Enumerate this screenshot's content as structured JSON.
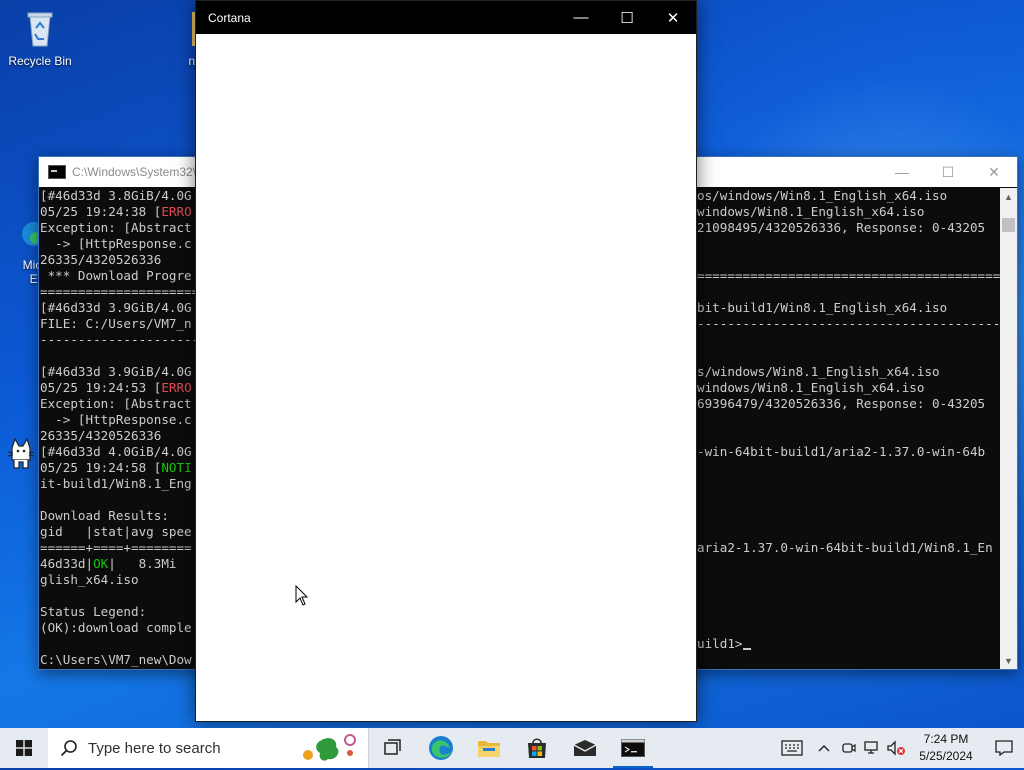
{
  "desktop": {
    "icons": [
      {
        "label": "Recycle Bin"
      },
      {
        "label": "nek"
      },
      {
        "label": "Micr"
      },
      {
        "label": "Ed"
      }
    ]
  },
  "console_window": {
    "title": "C:\\Windows\\System32\\",
    "controls": {
      "minimize": "—",
      "maximize": "☐",
      "close": "✕"
    }
  },
  "cortana_window": {
    "title": "Cortana",
    "controls": {
      "minimize": "—",
      "maximize": "☐",
      "close": "✕"
    }
  },
  "console_left_lines": [
    {
      "text": "[#46d33d 3.8GiB/4.0G",
      "colored": ""
    },
    {
      "text": "05/25 19:24:38 [",
      "colored": "ERRO"
    },
    {
      "text": "Exception: [Abstract",
      "colored": ""
    },
    {
      "text": "  -> [HttpResponse.c",
      "colored": ""
    },
    {
      "text": "26335/4320526336",
      "colored": ""
    },
    {
      "text": " *** Download Progre",
      "colored": ""
    },
    {
      "text": "=====================",
      "colored": ""
    },
    {
      "text": "[#46d33d 3.9GiB/4.0G",
      "colored": ""
    },
    {
      "text": "FILE: C:/Users/VM7_n",
      "colored": ""
    },
    {
      "text": "---------------------",
      "colored": ""
    },
    {
      "text": "",
      "colored": ""
    },
    {
      "text": "[#46d33d 3.9GiB/4.0G",
      "colored": ""
    },
    {
      "text": "05/25 19:24:53 [",
      "colored": "ERRO"
    },
    {
      "text": "Exception: [Abstract",
      "colored": ""
    },
    {
      "text": "  -> [HttpResponse.c",
      "colored": ""
    },
    {
      "text": "26335/4320526336",
      "colored": ""
    },
    {
      "text": "[#46d33d 4.0GiB/4.0G",
      "colored": ""
    },
    {
      "text": "05/25 19:24:58 [",
      "colored": "NOTI"
    },
    {
      "text": "it-build1/Win8.1_Eng",
      "colored": ""
    },
    {
      "text": "",
      "colored": ""
    },
    {
      "text": "Download Results:",
      "colored": ""
    },
    {
      "text": "gid   |stat|avg spee",
      "colored": ""
    },
    {
      "text": "======+====+========",
      "colored": ""
    },
    {
      "text": "46d33d|",
      "colored": "OK"
    },
    {
      "text": "glish_x64.iso",
      "colored": ""
    },
    {
      "text": "",
      "colored": ""
    },
    {
      "text": "Status Legend:",
      "colored": ""
    },
    {
      "text": "(OK):download comple",
      "colored": ""
    },
    {
      "text": "",
      "colored": ""
    },
    {
      "text": "C:\\Users\\VM7_new\\Dow",
      "colored": ""
    }
  ],
  "console_right_lines": [
    "",
    "os/windows/Win8.1_English_x64.iso",
    "windows/Win8.1_English_x64.iso",
    "21098495/4320526336, Response: 0-43205",
    "",
    "",
    "=====================================================",
    "",
    "bit-build1/Win8.1_English_x64.iso",
    "-----------------------------------------------------",
    "",
    "",
    "s/windows/Win8.1_English_x64.iso",
    "windows/Win8.1_English_x64.iso",
    "69396479/4320526336, Response: 0-43205",
    "",
    "",
    "-win-64bit-build1/aria2-1.37.0-win-64b",
    "",
    "",
    "",
    "",
    "",
    "aria2-1.37.0-win-64bit-build1/Win8.1_En",
    "",
    "",
    "",
    "",
    "",
    "uild1>"
  ],
  "console_ok_rest": "|   8.3Mi",
  "taskbar": {
    "search_placeholder": "Type here to search",
    "clock_time": "7:24 PM",
    "clock_date": "5/25/2024",
    "apps": [
      "task-view",
      "edge",
      "file-explorer",
      "microsoft-store",
      "mail",
      "terminal"
    ]
  },
  "colors": {
    "taskbar_bg": "#e6ebf1",
    "console_bg": "#0c0c0c",
    "error_red": "#e74856",
    "ok_green": "#16c60c",
    "accent": "#0a64c8"
  }
}
